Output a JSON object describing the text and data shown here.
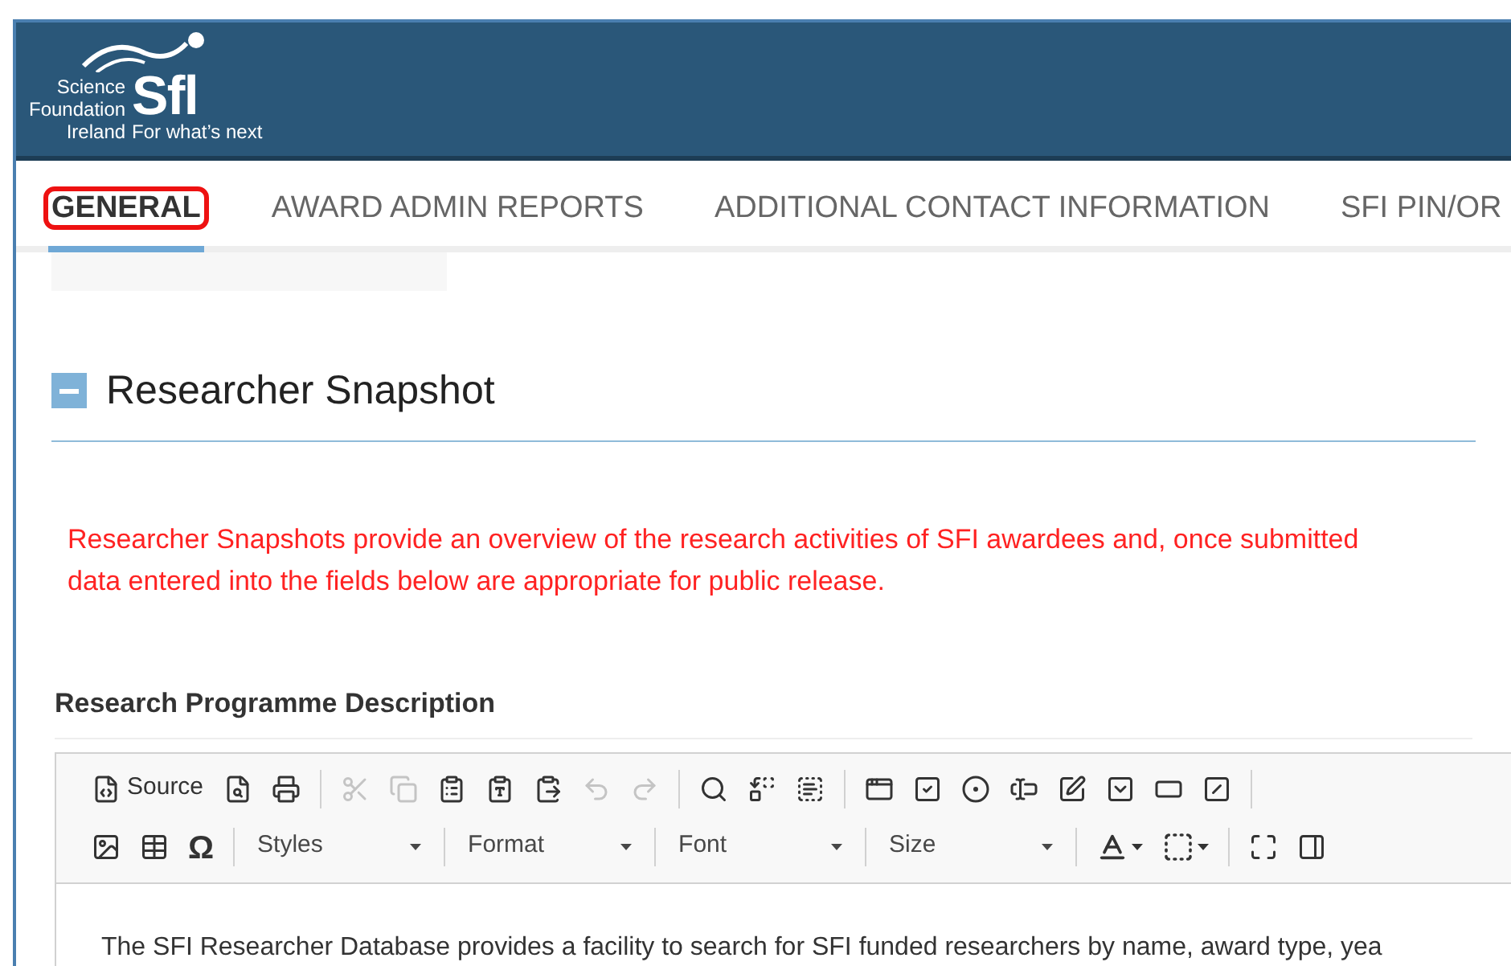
{
  "header": {
    "logo": {
      "org_lines": [
        "Science",
        "Foundation",
        "Ireland"
      ],
      "mark": "Sfl",
      "tagline": "For what’s next"
    }
  },
  "tabs": [
    {
      "label": "GENERAL",
      "selected": true,
      "highlighted": true
    },
    {
      "label": "AWARD ADMIN REPORTS",
      "selected": false,
      "highlighted": false
    },
    {
      "label": "ADDITIONAL CONTACT INFORMATION",
      "selected": false,
      "highlighted": false
    },
    {
      "label": "SFI PIN/OR",
      "selected": false,
      "highlighted": false
    }
  ],
  "section": {
    "title": "Researcher Snapshot",
    "expanded": true,
    "notice_lines": [
      "Researcher Snapshots provide an overview of the research activities of SFI awardees and, once submitted",
      "data entered into the fields below are appropriate for public release."
    ],
    "field_label": "Research Programme Description",
    "editor": {
      "toolbar": [
        [
          {
            "kind": "button",
            "label": "Source",
            "disabled": false
          },
          {
            "kind": "button",
            "disabled": false
          },
          {
            "kind": "button",
            "disabled": false
          },
          {
            "kind": "separator"
          },
          {
            "kind": "button",
            "disabled": true
          },
          {
            "kind": "button",
            "disabled": true
          },
          {
            "kind": "button",
            "disabled": false
          },
          {
            "kind": "button",
            "disabled": false
          },
          {
            "kind": "button",
            "disabled": false
          },
          {
            "kind": "button",
            "disabled": true
          },
          {
            "kind": "button",
            "disabled": true
          },
          {
            "kind": "separator"
          },
          {
            "kind": "button",
            "disabled": false
          },
          {
            "kind": "button",
            "disabled": false
          },
          {
            "kind": "button",
            "disabled": false
          },
          {
            "kind": "separator"
          },
          {
            "kind": "button",
            "disabled": false
          },
          {
            "kind": "button",
            "disabled": false
          },
          {
            "kind": "button",
            "disabled": false
          },
          {
            "kind": "button",
            "disabled": false
          },
          {
            "kind": "button",
            "disabled": false
          },
          {
            "kind": "button",
            "disabled": false
          },
          {
            "kind": "button",
            "disabled": false
          },
          {
            "kind": "button",
            "disabled": false
          },
          {
            "kind": "separator"
          }
        ],
        [
          {
            "kind": "button",
            "disabled": false
          },
          {
            "kind": "button",
            "disabled": false
          },
          {
            "kind": "glyph",
            "label": "Ω",
            "disabled": false
          },
          {
            "kind": "separator"
          },
          {
            "kind": "dropdown",
            "label": "Styles"
          },
          {
            "kind": "separator"
          },
          {
            "kind": "dropdown",
            "label": "Format"
          },
          {
            "kind": "separator"
          },
          {
            "kind": "dropdown",
            "label": "Font"
          },
          {
            "kind": "separator"
          },
          {
            "kind": "dropdown",
            "label": "Size"
          },
          {
            "kind": "separator"
          },
          {
            "kind": "color",
            "disabled": false
          },
          {
            "kind": "color",
            "disabled": false
          },
          {
            "kind": "separator"
          },
          {
            "kind": "button",
            "disabled": false
          },
          {
            "kind": "button",
            "disabled": false
          }
        ]
      ],
      "content": "The SFI Researcher Database provides a facility to search for SFI funded researchers by name, award type, yea"
    }
  }
}
